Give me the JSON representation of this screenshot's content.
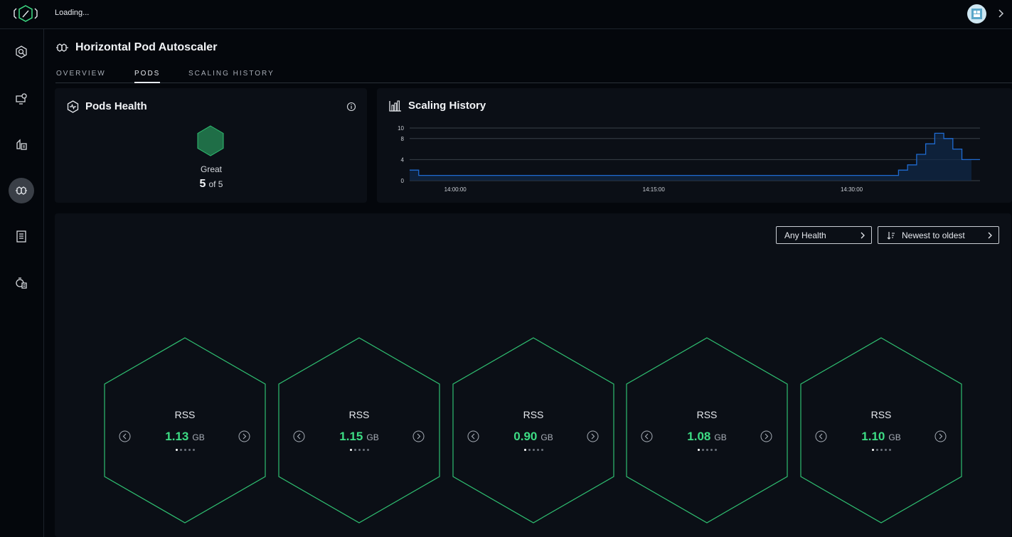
{
  "topbar": {
    "status_text": "Loading..."
  },
  "page": {
    "title": "Horizontal Pod Autoscaler"
  },
  "tabs": [
    {
      "label": "OVERVIEW",
      "active": false
    },
    {
      "label": "PODS",
      "active": true
    },
    {
      "label": "SCALING HISTORY",
      "active": false
    }
  ],
  "sidebar": {
    "items": [
      {
        "icon": "gear-search-icon",
        "active": false
      },
      {
        "icon": "monitor-gear-icon",
        "active": false
      },
      {
        "icon": "cluster-list-icon",
        "active": false
      },
      {
        "icon": "autoscaler-icon",
        "active": true
      },
      {
        "icon": "checklist-icon",
        "active": false
      },
      {
        "icon": "timer-list-icon",
        "active": false
      }
    ]
  },
  "pods_health": {
    "title": "Pods Health",
    "status": "Great",
    "healthy": "5",
    "of_label": "of 5",
    "color": "#1f6e47"
  },
  "scaling_history": {
    "title": "Scaling History",
    "chart_data": {
      "type": "area",
      "yticks": [
        "10",
        "8",
        "4",
        "0"
      ],
      "xticks": [
        "14:00:00",
        "14:15:00",
        "14:30:00"
      ],
      "ylim": [
        0,
        10
      ],
      "x": [
        0,
        1,
        2,
        3,
        4,
        5,
        6,
        7,
        8,
        9,
        10,
        11,
        12,
        13,
        14,
        15,
        16,
        17,
        18,
        19,
        20,
        21,
        22,
        23,
        24,
        25,
        26,
        27,
        28,
        29,
        30,
        31,
        32,
        33,
        34,
        35,
        36,
        37,
        38,
        39,
        40,
        41,
        42,
        43,
        44,
        45,
        46,
        47,
        48,
        49,
        50,
        51,
        52,
        53,
        54,
        55,
        56,
        57,
        58,
        59,
        60,
        61,
        62,
        63
      ],
      "values": [
        2,
        1,
        1,
        1,
        1,
        1,
        1,
        1,
        1,
        1,
        1,
        1,
        1,
        1,
        1,
        1,
        1,
        1,
        1,
        1,
        1,
        1,
        1,
        1,
        1,
        1,
        1,
        1,
        1,
        1,
        1,
        1,
        1,
        1,
        1,
        1,
        1,
        1,
        1,
        1,
        1,
        1,
        1,
        1,
        1,
        1,
        1,
        1,
        1,
        1,
        1,
        1,
        1,
        1,
        2,
        3,
        5,
        7,
        9,
        8,
        6,
        4,
        4,
        4
      ],
      "color": "#1f6bd1",
      "grid": true
    }
  },
  "filters": {
    "health": "Any Health",
    "sort": "Newest to oldest"
  },
  "pods": [
    {
      "metric": "RSS",
      "value": "1.13",
      "unit": "GB"
    },
    {
      "metric": "RSS",
      "value": "1.15",
      "unit": "GB"
    },
    {
      "metric": "RSS",
      "value": "0.90",
      "unit": "GB"
    },
    {
      "metric": "RSS",
      "value": "1.08",
      "unit": "GB"
    },
    {
      "metric": "RSS",
      "value": "1.10",
      "unit": "GB"
    }
  ],
  "colors": {
    "accent_green": "#3ddc84",
    "hex_border": "#2fbf71"
  }
}
